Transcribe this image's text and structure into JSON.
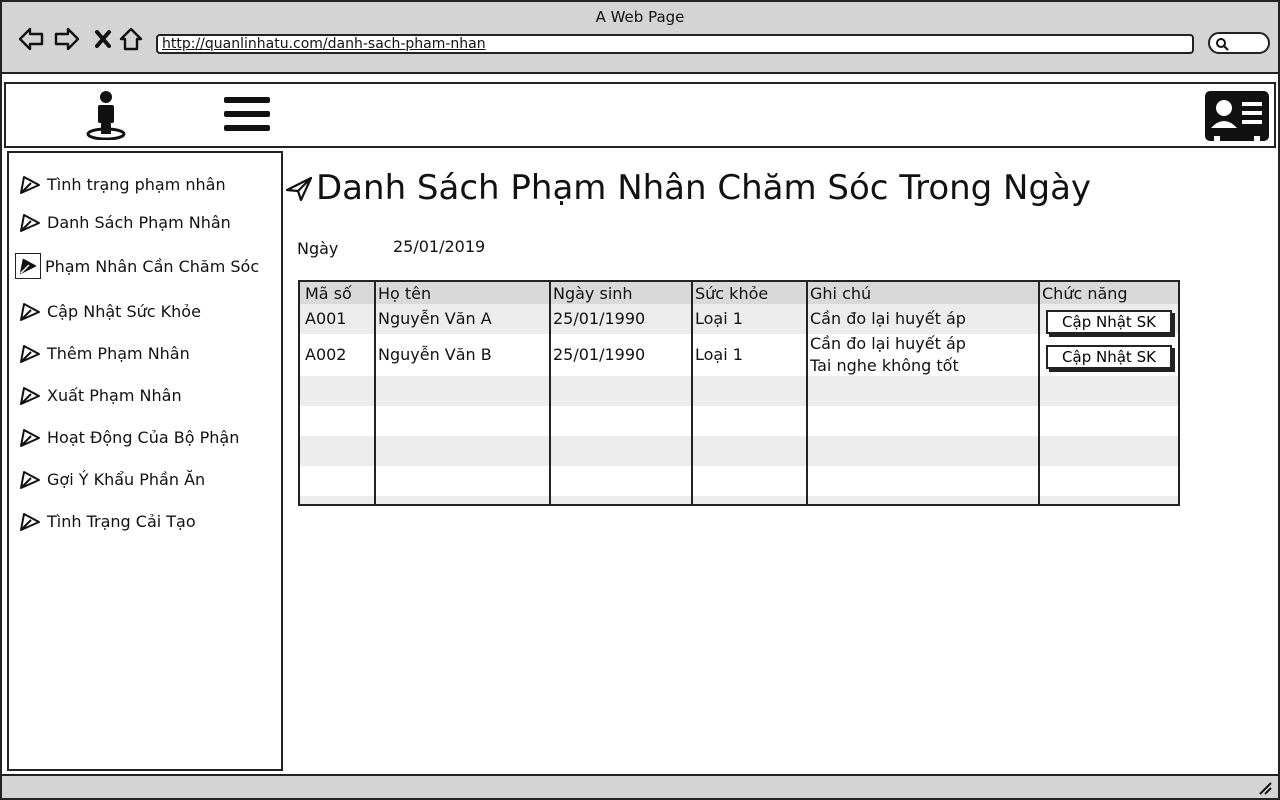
{
  "window": {
    "title": "A Web Page",
    "url": "http://quanlinhatu.com/danh-sach-pham-nhan"
  },
  "sidebar": {
    "items": [
      {
        "label": "Tình trạng phạm nhân"
      },
      {
        "label": "Danh Sách Phạm Nhân"
      },
      {
        "label": "Phạm Nhân Cần Chăm Sóc"
      },
      {
        "label": "Cập Nhật Sức Khỏe"
      },
      {
        "label": "Thêm Phạm Nhân"
      },
      {
        "label": "Xuất Phạm Nhân"
      },
      {
        "label": "Hoạt Động Của Bộ Phận"
      },
      {
        "label": "Gợi Ý Khẩu Phần Ăn"
      },
      {
        "label": "Tình Trạng Cải Tạo"
      }
    ],
    "active_index": 2
  },
  "main": {
    "title": "Danh Sách Phạm Nhân Chăm Sóc Trong Ngày",
    "date_label": "Ngày",
    "date_value": "25/01/2019"
  },
  "table": {
    "columns": [
      "Mã số",
      "Họ tên",
      "Ngày sinh",
      "Sức khỏe",
      "Ghi chú",
      "Chức năng"
    ],
    "rows": [
      {
        "ma_so": "A001",
        "ho_ten": "Nguyễn Văn A",
        "ngay_sinh": "25/01/1990",
        "suc_khoe": "Loại 1",
        "ghi_chu_1": "Cần đo lại huyết áp",
        "ghi_chu_2": "",
        "action": "Cập Nhật SK"
      },
      {
        "ma_so": "A002",
        "ho_ten": "Nguyễn Văn B",
        "ngay_sinh": "25/01/1990",
        "suc_khoe": "Loại 1",
        "ghi_chu_1": "Cần đo lại huyết áp",
        "ghi_chu_2": "Tai nghe không tốt",
        "action": "Cập Nhật SK"
      }
    ]
  },
  "icons": {
    "back": "back-arrow-icon",
    "forward": "forward-arrow-icon",
    "stop": "close-icon",
    "home": "home-icon",
    "search": "search-icon",
    "user": "user-location-icon",
    "menu": "hamburger-menu-icon",
    "profile": "id-card-icon",
    "nav": "pencil-icon",
    "title": "send-icon"
  },
  "colors": {
    "chrome": "#d4d4d4",
    "header_row": "#d9d9d9",
    "stripe": "#ececec",
    "ink": "#222222"
  }
}
